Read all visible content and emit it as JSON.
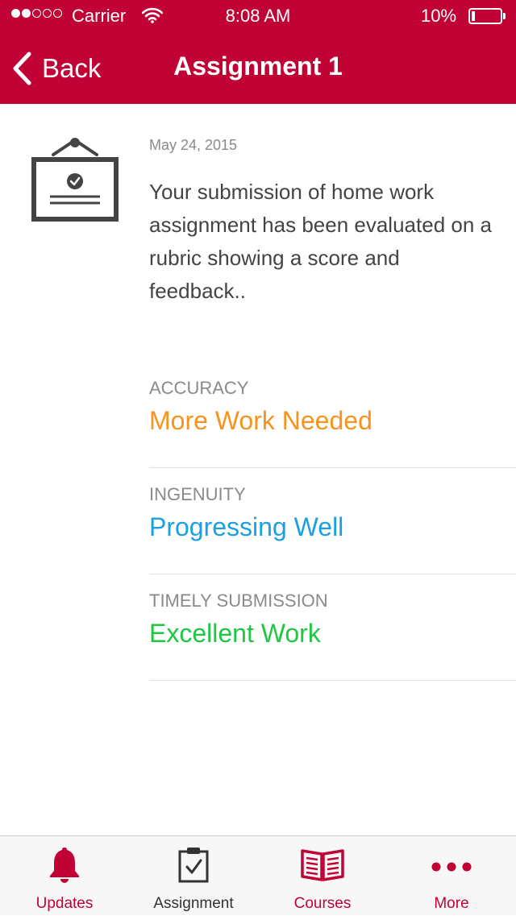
{
  "status_bar": {
    "carrier": "Carrier",
    "time": "8:08 AM",
    "battery": "10%"
  },
  "nav": {
    "back_label": "Back",
    "title": "Assignment 1"
  },
  "notification": {
    "icon": "assignment-board-icon",
    "date": "May 24, 2015",
    "message": "Your submission of home work assignment has been evaluated on a rubric showing a score and feedback.."
  },
  "rubric": [
    {
      "criterion": "ACCURACY",
      "score": "More Work Needed",
      "color": "#f7931e"
    },
    {
      "criterion": "INGENUITY",
      "score": "Progressing Well",
      "color": "#1ba1e2"
    },
    {
      "criterion": "TIMELY SUBMISSION",
      "score": "Excellent Work",
      "color": "#1fc742"
    }
  ],
  "tabs": [
    {
      "label": "Updates",
      "icon": "bell-icon",
      "active": true
    },
    {
      "label": "Assignment",
      "icon": "clipboard-check-icon",
      "active": false
    },
    {
      "label": "Courses",
      "icon": "open-book-icon",
      "active": false
    },
    {
      "label": "More",
      "icon": "more-dots-icon",
      "active": false
    }
  ],
  "colors": {
    "brand": "#c10235",
    "text_muted": "#8a8a8a",
    "tab_inactive": "#333333"
  }
}
